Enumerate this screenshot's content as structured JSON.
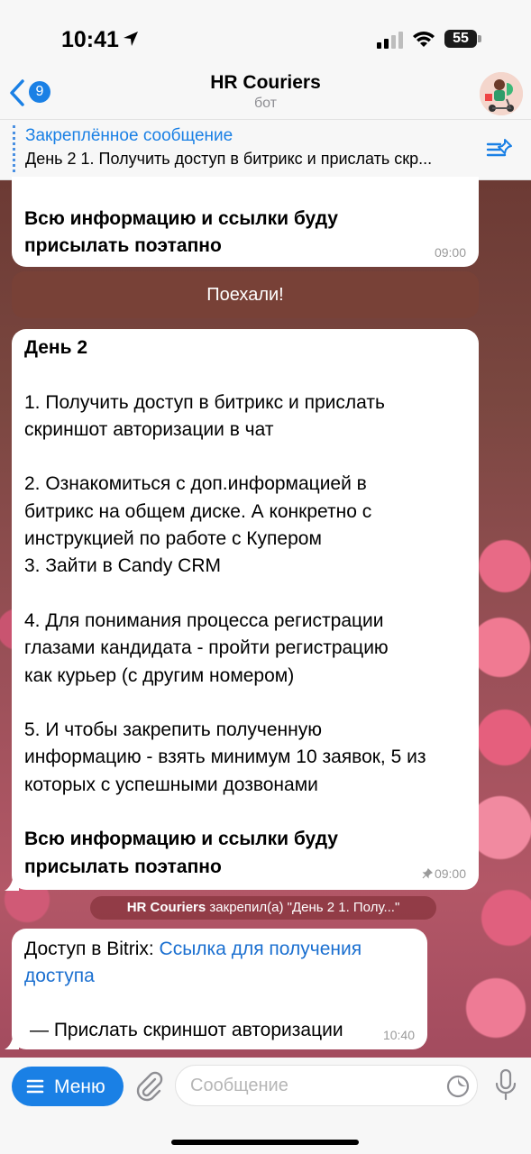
{
  "status_bar": {
    "time": "10:41",
    "battery": "55"
  },
  "header": {
    "back_count": "9",
    "title": "HR Couriers",
    "subtitle": "бот"
  },
  "pinned": {
    "title": "Закреплённое сообщение",
    "text": "День 2 1. Получить доступ в битрикс и прислать скр..."
  },
  "messages": {
    "m1": {
      "bold_lines": [
        "Всю информацию и ссылки буду",
        "присылать поэтапно"
      ],
      "time": "09:00"
    },
    "keyboard_button": "Поехали!",
    "m2": {
      "heading": "День 2",
      "lines": [
        "1. Получить доступ в битрикс и прислать",
        "скриншот авторизации в чат",
        "2. Ознакомиться с доп.информацией в",
        "битрикс на общем диске. А конкретно с",
        "инструкцией по работе с Купером",
        "3. Зайти в Candy CRM",
        "4. Для понимания процесса регистрации",
        "глазами кандидата - пройти регистрацию",
        "как курьер (с другим номером)",
        "5. И чтобы закрепить полученную",
        "информацию - взять минимум 10 заявок, 5 из",
        "которых с успешными дозвонами"
      ],
      "bold_lines": [
        "Всю информацию и ссылки буду",
        "присылать поэтапно"
      ],
      "time": "09:00"
    },
    "service": {
      "actor": "HR Couriers",
      "text": "закрепил(а) \"День 2  1. Полу...\""
    },
    "m3": {
      "prefix": "Доступ в Bitrix:  ",
      "link": "Ссылка для получения доступа",
      "last_line": "— Прислать скриншот авторизации",
      "time": "10:40"
    }
  },
  "input_bar": {
    "menu_label": "Меню",
    "placeholder": "Сообщение"
  },
  "colors": {
    "accent": "#1a80e5",
    "link": "#1a6fd0",
    "keyboard_button": "#784137"
  }
}
